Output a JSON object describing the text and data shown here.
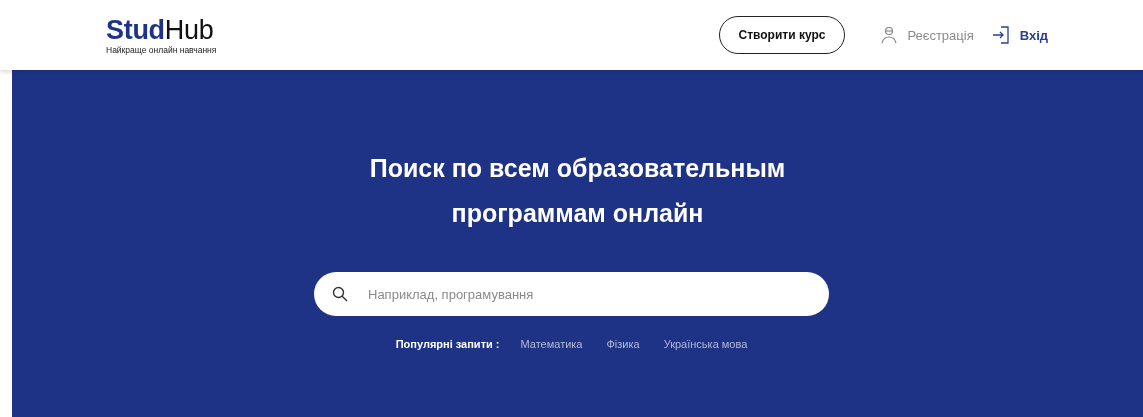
{
  "header": {
    "logo": {
      "primary": "Stud",
      "secondary": "Hub"
    },
    "tagline": "Найкраще онлайн навчання",
    "create_course_button": "Створити курс",
    "register_link": "Реєстрація",
    "login_link": "Вхід"
  },
  "hero": {
    "title_lines": [
      "Поиск по всем образовательным",
      "программам онлайн"
    ],
    "search": {
      "placeholder": "Наприклад, програмування"
    },
    "popular": {
      "label": "Популярні запити :",
      "queries": [
        "Математика",
        "Фізика",
        "Українська мова"
      ]
    }
  }
}
